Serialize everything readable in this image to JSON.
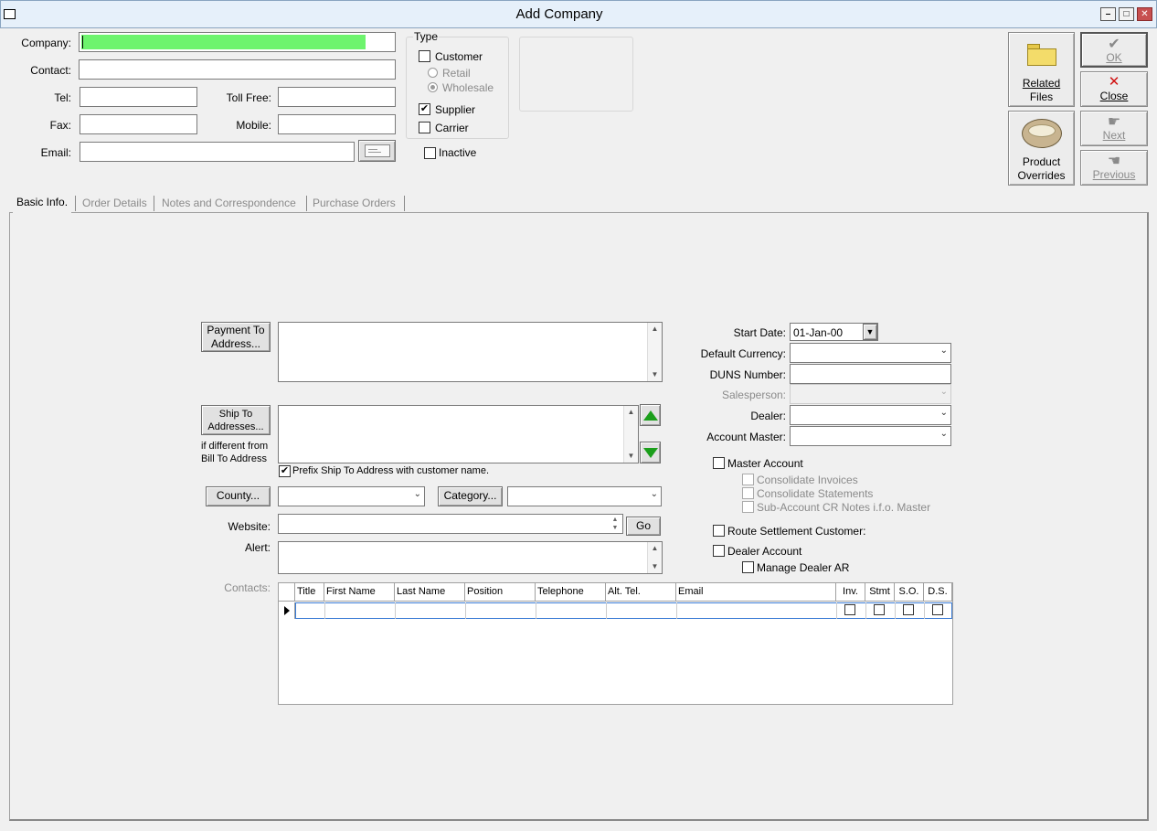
{
  "window": {
    "title": "Add Company"
  },
  "header": {
    "company_label": "Company:",
    "contact_label": "Contact:",
    "tel_label": "Tel:",
    "tollfree_label": "Toll Free:",
    "fax_label": "Fax:",
    "mobile_label": "Mobile:",
    "email_label": "Email:",
    "company_value": "",
    "contact_value": "",
    "tel_value": "",
    "tollfree_value": "",
    "fax_value": "",
    "mobile_value": "",
    "email_value": ""
  },
  "type_group": {
    "title": "Type",
    "customer": "Customer",
    "retail": "Retail",
    "wholesale": "Wholesale",
    "supplier": "Supplier",
    "carrier": "Carrier",
    "inactive": "Inactive",
    "customer_checked": false,
    "supplier_checked": true,
    "carrier_checked": false,
    "inactive_checked": false,
    "wholesale_selected": true
  },
  "buttons": {
    "related_files_line1": "Related",
    "related_files_line2": "Files",
    "product_overrides_line1": "Product",
    "product_overrides_line2": "Overrides",
    "ok": "OK",
    "close": "Close",
    "next": "Next",
    "previous": "Previous"
  },
  "tabs": [
    "Basic Info.",
    "Order Details",
    "Notes and Correspondence",
    "Purchase Orders"
  ],
  "basic": {
    "payment_to_line1": "Payment To",
    "payment_to_line2": "Address...",
    "ship_to_line1": "Ship To",
    "ship_to_line2": "Addresses...",
    "ship_note_line1": "if different from",
    "ship_note_line2": "Bill To Address",
    "prefix_ship": "Prefix Ship To Address with customer name.",
    "prefix_checked": true,
    "county_btn": "County...",
    "category_btn": "Category...",
    "website_label": "Website:",
    "go_btn": "Go",
    "alert_label": "Alert:",
    "contacts_label": "Contacts:",
    "start_date_label": "Start Date:",
    "start_date_value": "01-Jan-00",
    "default_currency_label": "Default Currency:",
    "duns_label": "DUNS Number:",
    "salesperson_label": "Salesperson:",
    "dealer_label": "Dealer:",
    "account_master_label": "Account Master:",
    "master_account": "Master Account",
    "consolidate_invoices": "Consolidate Invoices",
    "consolidate_statements": "Consolidate Statements",
    "sub_account_cr": "Sub-Account CR Notes i.f.o. Master",
    "route_settlement": "Route Settlement Customer:",
    "dealer_account": "Dealer Account",
    "manage_dealer_ar": "Manage Dealer AR"
  },
  "contacts_grid": {
    "columns": [
      "Title",
      "First Name",
      "Last Name",
      "Position",
      "Telephone",
      "Alt. Tel.",
      "Email",
      "Inv.",
      "Stmt",
      "S.O.",
      "D.S."
    ]
  }
}
